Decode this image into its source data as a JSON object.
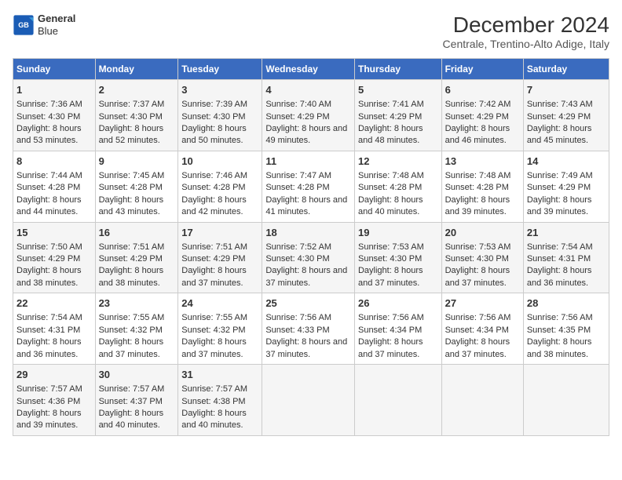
{
  "logo": {
    "line1": "General",
    "line2": "Blue"
  },
  "title": "December 2024",
  "subtitle": "Centrale, Trentino-Alto Adige, Italy",
  "days_of_week": [
    "Sunday",
    "Monday",
    "Tuesday",
    "Wednesday",
    "Thursday",
    "Friday",
    "Saturday"
  ],
  "weeks": [
    [
      {
        "day": "1",
        "sunrise": "7:36 AM",
        "sunset": "4:30 PM",
        "daylight": "8 hours and 53 minutes."
      },
      {
        "day": "2",
        "sunrise": "7:37 AM",
        "sunset": "4:30 PM",
        "daylight": "8 hours and 52 minutes."
      },
      {
        "day": "3",
        "sunrise": "7:39 AM",
        "sunset": "4:30 PM",
        "daylight": "8 hours and 50 minutes."
      },
      {
        "day": "4",
        "sunrise": "7:40 AM",
        "sunset": "4:29 PM",
        "daylight": "8 hours and 49 minutes."
      },
      {
        "day": "5",
        "sunrise": "7:41 AM",
        "sunset": "4:29 PM",
        "daylight": "8 hours and 48 minutes."
      },
      {
        "day": "6",
        "sunrise": "7:42 AM",
        "sunset": "4:29 PM",
        "daylight": "8 hours and 46 minutes."
      },
      {
        "day": "7",
        "sunrise": "7:43 AM",
        "sunset": "4:29 PM",
        "daylight": "8 hours and 45 minutes."
      }
    ],
    [
      {
        "day": "8",
        "sunrise": "7:44 AM",
        "sunset": "4:28 PM",
        "daylight": "8 hours and 44 minutes."
      },
      {
        "day": "9",
        "sunrise": "7:45 AM",
        "sunset": "4:28 PM",
        "daylight": "8 hours and 43 minutes."
      },
      {
        "day": "10",
        "sunrise": "7:46 AM",
        "sunset": "4:28 PM",
        "daylight": "8 hours and 42 minutes."
      },
      {
        "day": "11",
        "sunrise": "7:47 AM",
        "sunset": "4:28 PM",
        "daylight": "8 hours and 41 minutes."
      },
      {
        "day": "12",
        "sunrise": "7:48 AM",
        "sunset": "4:28 PM",
        "daylight": "8 hours and 40 minutes."
      },
      {
        "day": "13",
        "sunrise": "7:48 AM",
        "sunset": "4:28 PM",
        "daylight": "8 hours and 39 minutes."
      },
      {
        "day": "14",
        "sunrise": "7:49 AM",
        "sunset": "4:29 PM",
        "daylight": "8 hours and 39 minutes."
      }
    ],
    [
      {
        "day": "15",
        "sunrise": "7:50 AM",
        "sunset": "4:29 PM",
        "daylight": "8 hours and 38 minutes."
      },
      {
        "day": "16",
        "sunrise": "7:51 AM",
        "sunset": "4:29 PM",
        "daylight": "8 hours and 38 minutes."
      },
      {
        "day": "17",
        "sunrise": "7:51 AM",
        "sunset": "4:29 PM",
        "daylight": "8 hours and 37 minutes."
      },
      {
        "day": "18",
        "sunrise": "7:52 AM",
        "sunset": "4:30 PM",
        "daylight": "8 hours and 37 minutes."
      },
      {
        "day": "19",
        "sunrise": "7:53 AM",
        "sunset": "4:30 PM",
        "daylight": "8 hours and 37 minutes."
      },
      {
        "day": "20",
        "sunrise": "7:53 AM",
        "sunset": "4:30 PM",
        "daylight": "8 hours and 37 minutes."
      },
      {
        "day": "21",
        "sunrise": "7:54 AM",
        "sunset": "4:31 PM",
        "daylight": "8 hours and 36 minutes."
      }
    ],
    [
      {
        "day": "22",
        "sunrise": "7:54 AM",
        "sunset": "4:31 PM",
        "daylight": "8 hours and 36 minutes."
      },
      {
        "day": "23",
        "sunrise": "7:55 AM",
        "sunset": "4:32 PM",
        "daylight": "8 hours and 37 minutes."
      },
      {
        "day": "24",
        "sunrise": "7:55 AM",
        "sunset": "4:32 PM",
        "daylight": "8 hours and 37 minutes."
      },
      {
        "day": "25",
        "sunrise": "7:56 AM",
        "sunset": "4:33 PM",
        "daylight": "8 hours and 37 minutes."
      },
      {
        "day": "26",
        "sunrise": "7:56 AM",
        "sunset": "4:34 PM",
        "daylight": "8 hours and 37 minutes."
      },
      {
        "day": "27",
        "sunrise": "7:56 AM",
        "sunset": "4:34 PM",
        "daylight": "8 hours and 37 minutes."
      },
      {
        "day": "28",
        "sunrise": "7:56 AM",
        "sunset": "4:35 PM",
        "daylight": "8 hours and 38 minutes."
      }
    ],
    [
      {
        "day": "29",
        "sunrise": "7:57 AM",
        "sunset": "4:36 PM",
        "daylight": "8 hours and 39 minutes."
      },
      {
        "day": "30",
        "sunrise": "7:57 AM",
        "sunset": "4:37 PM",
        "daylight": "8 hours and 40 minutes."
      },
      {
        "day": "31",
        "sunrise": "7:57 AM",
        "sunset": "4:38 PM",
        "daylight": "8 hours and 40 minutes."
      },
      null,
      null,
      null,
      null
    ]
  ],
  "labels": {
    "sunrise": "Sunrise: ",
    "sunset": "Sunset: ",
    "daylight": "Daylight: "
  }
}
